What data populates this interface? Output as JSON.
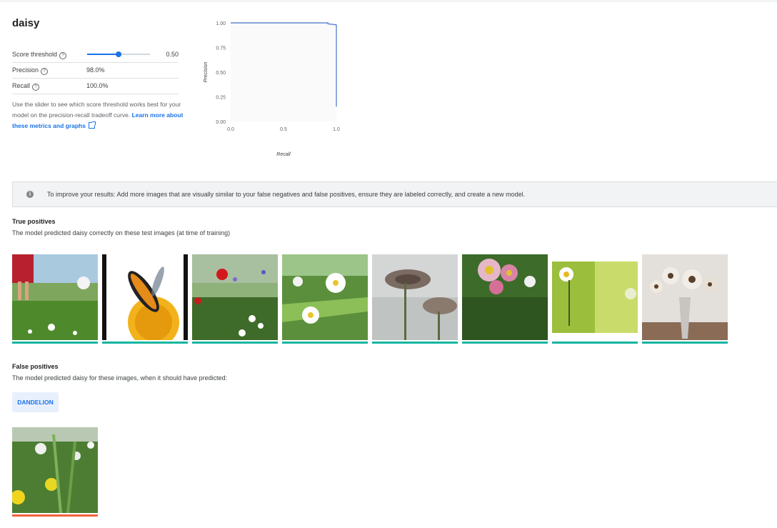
{
  "header": {
    "title": "daisy"
  },
  "metrics": {
    "threshold": {
      "label": "Score threshold",
      "value": "0.50",
      "fraction": 0.5
    },
    "precision": {
      "label": "Precision",
      "value": "98.0%"
    },
    "recall": {
      "label": "Recall",
      "value": "100.0%"
    }
  },
  "help": {
    "text": "Use the slider to see which score threshold works best for your model on the precision-recall tradeoff curve.",
    "link": "Learn more about these metrics and graphs"
  },
  "chart_data": {
    "type": "line",
    "title": "",
    "xlabel": "Recall",
    "ylabel": "Precision",
    "xlim": [
      0.0,
      1.0
    ],
    "ylim": [
      0.0,
      1.0
    ],
    "x_ticks": [
      "0.0",
      "0.5",
      "1.0"
    ],
    "y_ticks": [
      "1.00",
      "0.75",
      "0.50",
      "0.25",
      "0.00"
    ],
    "x": [
      0.0,
      0.92,
      0.92,
      1.0,
      1.0
    ],
    "y": [
      1.0,
      1.0,
      0.99,
      0.98,
      0.15
    ],
    "color": "#4472c4"
  },
  "banner": {
    "icon": "info-icon",
    "text": "To improve your results: Add more images that are visually similar to your false negatives and false positives, ensure they are labeled correctly, and create a new model."
  },
  "true_positives": {
    "title": "True positives",
    "subtitle": "The model predicted daisy correctly on these test images (at time of training)",
    "bar_color": "#12b5a0",
    "count": 8
  },
  "false_positives": {
    "title": "False positives",
    "subtitle": "The model predicted daisy for these images, when it should have predicted:",
    "chip": "DANDELION",
    "bar_color": "#f4623a",
    "count": 1
  }
}
